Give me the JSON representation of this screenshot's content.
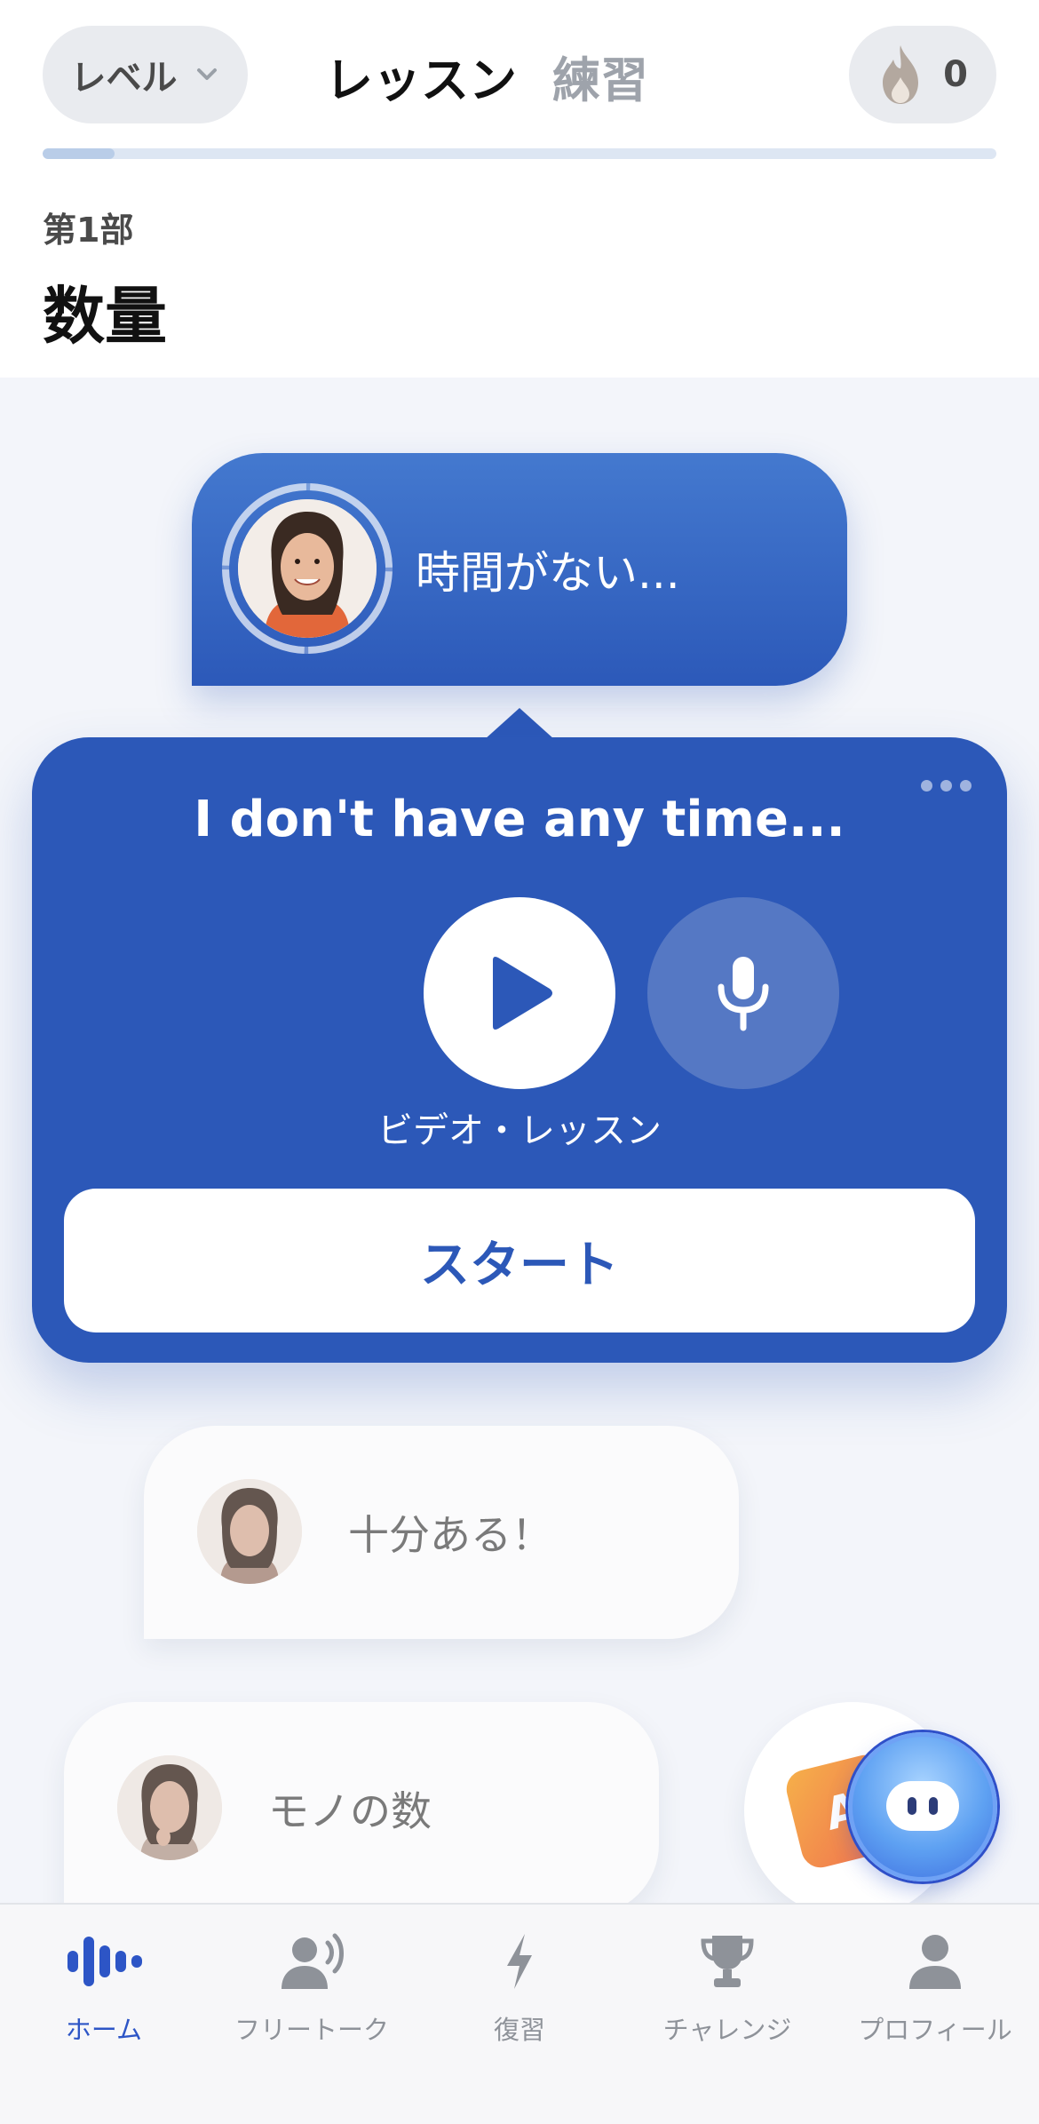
{
  "header": {
    "level_label": "レベル",
    "tabs": [
      {
        "label": "レッスン",
        "active": true
      },
      {
        "label": "練習",
        "active": false
      }
    ],
    "streak_count": "0",
    "progress_fraction": 0.075
  },
  "section": {
    "label": "第1部",
    "title": "数量"
  },
  "active_lesson": {
    "text": "時間がない..."
  },
  "popover": {
    "phrase": "I don't have any time...",
    "video_label": "ビデオ・レッスン",
    "start_label": "スタート"
  },
  "lessons": [
    {
      "text": "十分ある！"
    },
    {
      "text": "モノの数"
    }
  ],
  "assistant": {
    "card_letter": "A"
  },
  "nav": {
    "items": [
      {
        "label": "ホーム",
        "icon": "home-waveform-icon",
        "active": true
      },
      {
        "label": "フリートーク",
        "icon": "speaking-person-icon",
        "active": false
      },
      {
        "label": "復習",
        "icon": "lightning-icon",
        "active": false
      },
      {
        "label": "チャレンジ",
        "icon": "trophy-icon",
        "active": false
      },
      {
        "label": "プロフィール",
        "icon": "person-icon",
        "active": false
      }
    ]
  },
  "colors": {
    "primary_blue": "#2c58b8",
    "nav_active": "#2d55c6",
    "background": "#f3f5fa"
  }
}
